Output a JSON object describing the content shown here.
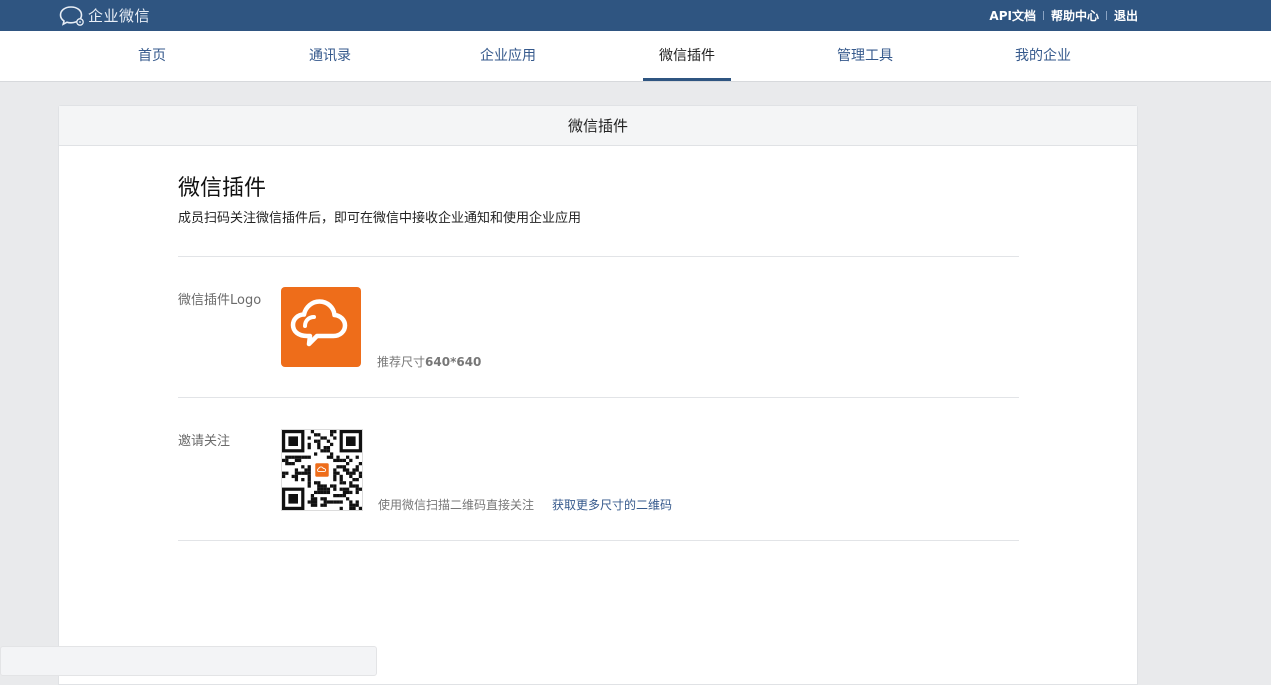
{
  "brand": {
    "name": "企业微信",
    "icon": "wechat-work-logo-icon"
  },
  "top_links": [
    {
      "label": "API文档"
    },
    {
      "label": "帮助中心"
    },
    {
      "label": "退出"
    }
  ],
  "nav": {
    "items": [
      {
        "label": "首页"
      },
      {
        "label": "通讯录"
      },
      {
        "label": "企业应用"
      },
      {
        "label": "微信插件",
        "active": true
      },
      {
        "label": "管理工具"
      },
      {
        "label": "我的企业"
      }
    ]
  },
  "card": {
    "header": "微信插件",
    "title": "微信插件",
    "description": "成员扫码关注微信插件后，即可在微信中接收企业通知和使用企业应用",
    "logo_row": {
      "label": "微信插件Logo",
      "hint_prefix": "推荐尺寸",
      "hint_size": "640*640",
      "logo_icon": "cloud-chat-icon",
      "logo_color": "#ee6d1a"
    },
    "invite_row": {
      "label": "邀请关注",
      "hint": "使用微信扫描二维码直接关注",
      "link": "获取更多尺寸的二维码",
      "qr_icon": "qr-code-icon"
    }
  },
  "colors": {
    "topbar": "#2f5581",
    "link": "#35598c",
    "background": "#e9eaec"
  }
}
